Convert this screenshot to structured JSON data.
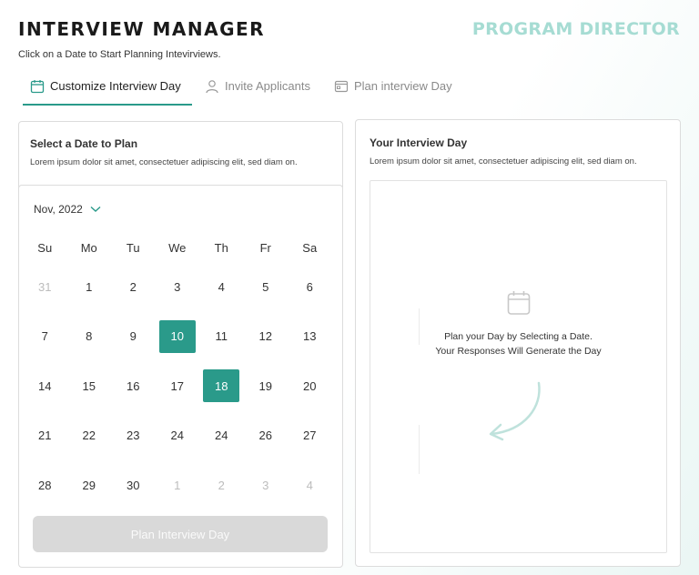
{
  "header": {
    "title": "INTERVIEW MANAGER",
    "role": "PROGRAM DIRECTOR",
    "subtitle": "Click on a Date to Start Planning Intevirviews."
  },
  "tabs": [
    {
      "label": "Customize Interview Day",
      "icon": "calendar-icon",
      "active": true
    },
    {
      "label": "Invite Applicants",
      "icon": "user-icon",
      "active": false
    },
    {
      "label": "Plan interview Day",
      "icon": "card-icon",
      "active": false
    }
  ],
  "left_panel": {
    "title": "Select a Date to Plan",
    "description": "Lorem ipsum dolor sit amet, consectetuer adipiscing elit, sed diam on.",
    "month": "Nov, 2022",
    "weekdays": [
      "Su",
      "Mo",
      "Tu",
      "We",
      "Th",
      "Fr",
      "Sa"
    ],
    "weeks": [
      [
        {
          "d": "31",
          "m": true
        },
        {
          "d": "1"
        },
        {
          "d": "2"
        },
        {
          "d": "3"
        },
        {
          "d": "4"
        },
        {
          "d": "5"
        },
        {
          "d": "6"
        }
      ],
      [
        {
          "d": "7"
        },
        {
          "d": "8"
        },
        {
          "d": "9"
        },
        {
          "d": "10",
          "s": true
        },
        {
          "d": "11"
        },
        {
          "d": "12"
        },
        {
          "d": "13"
        }
      ],
      [
        {
          "d": "14"
        },
        {
          "d": "15"
        },
        {
          "d": "16"
        },
        {
          "d": "17"
        },
        {
          "d": "18",
          "s": true
        },
        {
          "d": "19"
        },
        {
          "d": "20"
        }
      ],
      [
        {
          "d": "21"
        },
        {
          "d": "22"
        },
        {
          "d": "23"
        },
        {
          "d": "24"
        },
        {
          "d": "24"
        },
        {
          "d": "26"
        },
        {
          "d": "27"
        }
      ],
      [
        {
          "d": "28"
        },
        {
          "d": "29"
        },
        {
          "d": "30"
        },
        {
          "d": "1",
          "m": true
        },
        {
          "d": "2",
          "m": true
        },
        {
          "d": "3",
          "m": true
        },
        {
          "d": "4",
          "m": true
        }
      ]
    ],
    "button_label": "Plan Interview Day"
  },
  "right_panel": {
    "title": "Your Interview Day",
    "description": "Lorem ipsum dolor sit amet, consectetuer adipiscing elit, sed diam on.",
    "empty_line1": "Plan your Day by Selecting a Date.",
    "empty_line2": "Your Responses Will Generate the Day"
  },
  "colors": {
    "accent": "#2a9a8a",
    "role": "#a6dcd3",
    "disabled_button": "#d9d9d9"
  }
}
